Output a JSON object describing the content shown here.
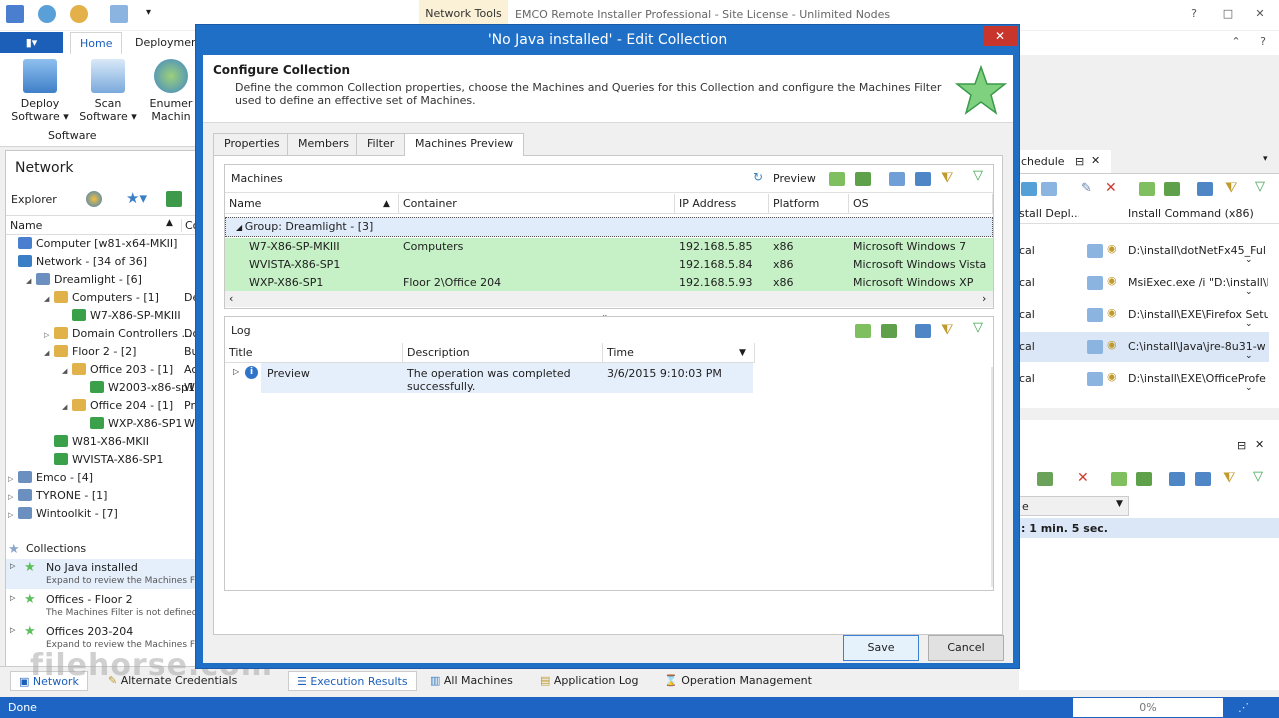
{
  "app": {
    "network_tools_tab": "Network Tools",
    "title": "EMCO Remote Installer Professional - Site License - Unlimited Nodes"
  },
  "ribbon": {
    "tabs": [
      "Home",
      "Deployment"
    ],
    "buttons": [
      {
        "line1": "Deploy",
        "line2": "Software ▾"
      },
      {
        "line1": "Scan",
        "line2": "Software ▾"
      },
      {
        "line1": "Enumer",
        "line2": "Machin"
      }
    ],
    "group_label": "Software"
  },
  "network_pane": {
    "title": "Network",
    "explorer_label": "Explorer",
    "col_name": "Name",
    "col_co": "Co",
    "tree": [
      {
        "label": "Computer [w81-x64-MKII]",
        "indent": 0
      },
      {
        "label": "Network - [34 of 36]",
        "indent": 0
      },
      {
        "label": "Dreamlight - [6]",
        "indent": 1
      },
      {
        "label": "Computers - [1]",
        "indent": 2,
        "extra": "De"
      },
      {
        "label": "W7-X86-SP-MKIII",
        "indent": 3
      },
      {
        "label": "Domain Controllers ...",
        "indent": 2,
        "extra": "Do"
      },
      {
        "label": "Floor 2 - [2]",
        "indent": 2,
        "extra": "Bu"
      },
      {
        "label": "Office 203 - [1]",
        "indent": 3,
        "extra": "Ac"
      },
      {
        "label": "W2003-x86-sp1",
        "indent": 4,
        "extra": "W"
      },
      {
        "label": "Office 204 - [1]",
        "indent": 3,
        "extra": "Pr"
      },
      {
        "label": "WXP-X86-SP1",
        "indent": 4,
        "extra": "W"
      },
      {
        "label": "W81-X86-MKII",
        "indent": 2
      },
      {
        "label": "WVISTA-X86-SP1",
        "indent": 2
      },
      {
        "label": "Emco - [4]",
        "indent": 0
      },
      {
        "label": "TYRONE - [1]",
        "indent": 0
      },
      {
        "label": "Wintoolkit - [7]",
        "indent": 0
      }
    ],
    "collections_label": "Collections",
    "collections": [
      {
        "name": "No Java installed",
        "sub": "Expand to review the Machines Filter"
      },
      {
        "name": "Offices - Floor 2",
        "sub": "The Machines Filter is not defined"
      },
      {
        "name": "Offices 203-204",
        "sub": "Expand to review the Machines Filter"
      }
    ]
  },
  "right_pane": {
    "tab_label": "chedule",
    "col1": "stall Depl...",
    "col2": "Install Command (x86)",
    "rows": [
      {
        "left": "cal",
        "cmd": "D:\\install\\dotNetFx45_Ful"
      },
      {
        "left": "cal",
        "cmd": "MsiExec.exe /i \"D:\\install\\F"
      },
      {
        "left": "cal",
        "cmd": "D:\\install\\EXE\\Firefox Setu"
      },
      {
        "left": "cal",
        "cmd": "C:\\install\\Java\\jre-8u31-w"
      },
      {
        "left": "cal",
        "cmd": "D:\\install\\EXE\\OfficeProfe"
      }
    ],
    "lower_col": "e",
    "lower_row": ": 1 min. 5 sec."
  },
  "dialog": {
    "title": "'No Java installed' - Edit Collection",
    "close": "✕",
    "heading": "Configure Collection",
    "description": "Define the common Collection properties, choose the Machines and Queries for this Collection and configure the Machines Filter used to define an effective set of Machines.",
    "tabs": [
      "Properties",
      "Members",
      "Filter",
      "Machines Preview"
    ],
    "machines_label": "Machines",
    "preview_label": "Preview",
    "columns": [
      "Name",
      "Container",
      "IP Address",
      "Platform",
      "OS"
    ],
    "group_row": "Group: Dreamlight - [3]",
    "machines": [
      {
        "name": "W7-X86-SP-MKIII",
        "container": "Computers",
        "ip": "192.168.5.85",
        "platform": "x86",
        "os": "Microsoft Windows 7"
      },
      {
        "name": "WVISTA-X86-SP1",
        "container": "",
        "ip": "192.168.5.84",
        "platform": "x86",
        "os": "Microsoft Windows Vista"
      },
      {
        "name": "WXP-X86-SP1",
        "container": "Floor 2\\Office 204",
        "ip": "192.168.5.93",
        "platform": "x86",
        "os": "Microsoft Windows XP"
      }
    ],
    "log_label": "Log",
    "log_columns": [
      "Title",
      "Description",
      "Time"
    ],
    "log_row": {
      "title": "Preview",
      "desc_line1": "The operation was completed",
      "desc_line2": "successfully.",
      "time": "3/6/2015 9:10:03 PM"
    },
    "save": "Save",
    "cancel": "Cancel"
  },
  "bottom_tabs": {
    "left": [
      "Network",
      "Alternate Credentials"
    ],
    "right": [
      "Execution Results",
      "All Machines",
      "Application Log",
      "Operation Management"
    ]
  },
  "status": {
    "text": "Done",
    "progress": "0%"
  },
  "watermark": "filehorse.com",
  "colors": {
    "accent": "#1d64c3",
    "machine_row": "#c6f0c6",
    "group_row": "#e1ecfa",
    "close": "#c8352d"
  }
}
